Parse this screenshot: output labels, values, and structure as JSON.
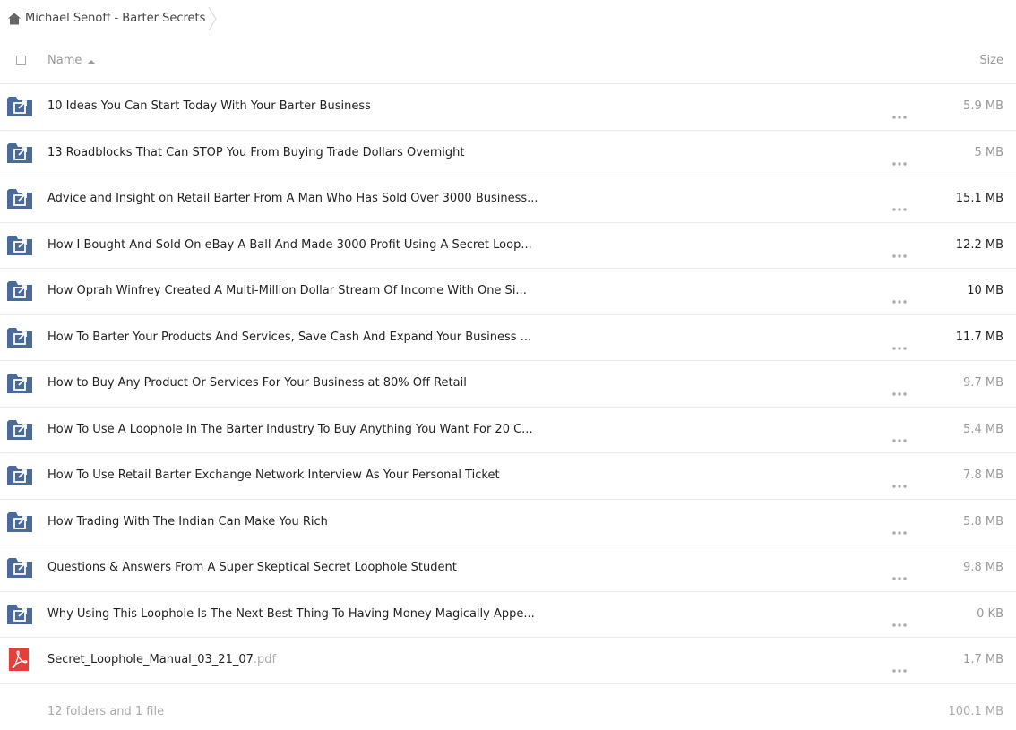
{
  "breadcrumb": {
    "label": "Michael Senoff - Barter Secrets"
  },
  "header": {
    "name_label": "Name",
    "size_label": "Size"
  },
  "files": [
    {
      "name": "10 Ideas You Can Start Today With Your Barter Business",
      "ext": "",
      "size": "5.9 MB",
      "type": "shared-folder"
    },
    {
      "name": "13 Roadblocks That Can STOP You From Buying Trade Dollars Overnight",
      "ext": "",
      "size": "5 MB",
      "type": "shared-folder"
    },
    {
      "name": "Advice and Insight on Retail Barter From A Man Who Has Sold Over 3000 Business...",
      "ext": "",
      "size": "15.1 MB",
      "type": "shared-folder"
    },
    {
      "name": "How I Bought And Sold On eBay A Ball And Made 3000 Profit Using A Secret Loop...",
      "ext": "",
      "size": "12.2 MB",
      "type": "shared-folder"
    },
    {
      "name": "How Oprah Winfrey Created A Multi-Million Dollar Stream Of Income With One Si...",
      "ext": "",
      "size": "10 MB",
      "type": "shared-folder"
    },
    {
      "name": "How To Barter Your Products And Services, Save Cash And Expand Your Business ...",
      "ext": "",
      "size": "11.7 MB",
      "type": "shared-folder"
    },
    {
      "name": "How to Buy Any Product Or Services For Your Business at 80% Off Retail",
      "ext": "",
      "size": "9.7 MB",
      "type": "shared-folder"
    },
    {
      "name": "How To Use A Loophole In The Barter Industry To Buy Anything You Want For 20 C...",
      "ext": "",
      "size": "5.4 MB",
      "type": "shared-folder"
    },
    {
      "name": "How To Use Retail Barter Exchange Network Interview As Your Personal Ticket",
      "ext": "",
      "size": "7.8 MB",
      "type": "shared-folder"
    },
    {
      "name": "How Trading With The Indian Can Make You Rich",
      "ext": "",
      "size": "5.8 MB",
      "type": "shared-folder"
    },
    {
      "name": "Questions & Answers From A Super Skeptical Secret Loophole Student",
      "ext": "",
      "size": "9.8 MB",
      "type": "shared-folder"
    },
    {
      "name": "Why Using This Loophole Is The Next Best Thing To Having Money Magically Appe...",
      "ext": "",
      "size": "0 KB",
      "type": "shared-folder"
    },
    {
      "name": "Secret_Loophole_Manual_03_21_07",
      "ext": ".pdf",
      "size": "1.7 MB",
      "type": "pdf"
    }
  ],
  "footer": {
    "summary": "12 folders and 1 file",
    "total": "100.1 MB"
  },
  "colors": {
    "folder": "#4a6a9a",
    "pdf": "#e0413a",
    "dark_size_threshold_note": "sizes ≥ 10 MB shown darker"
  },
  "icons": {
    "home": "home-icon",
    "shared_folder": "shared-folder-icon",
    "pdf": "pdf-file-icon",
    "more": "more-actions-icon"
  }
}
